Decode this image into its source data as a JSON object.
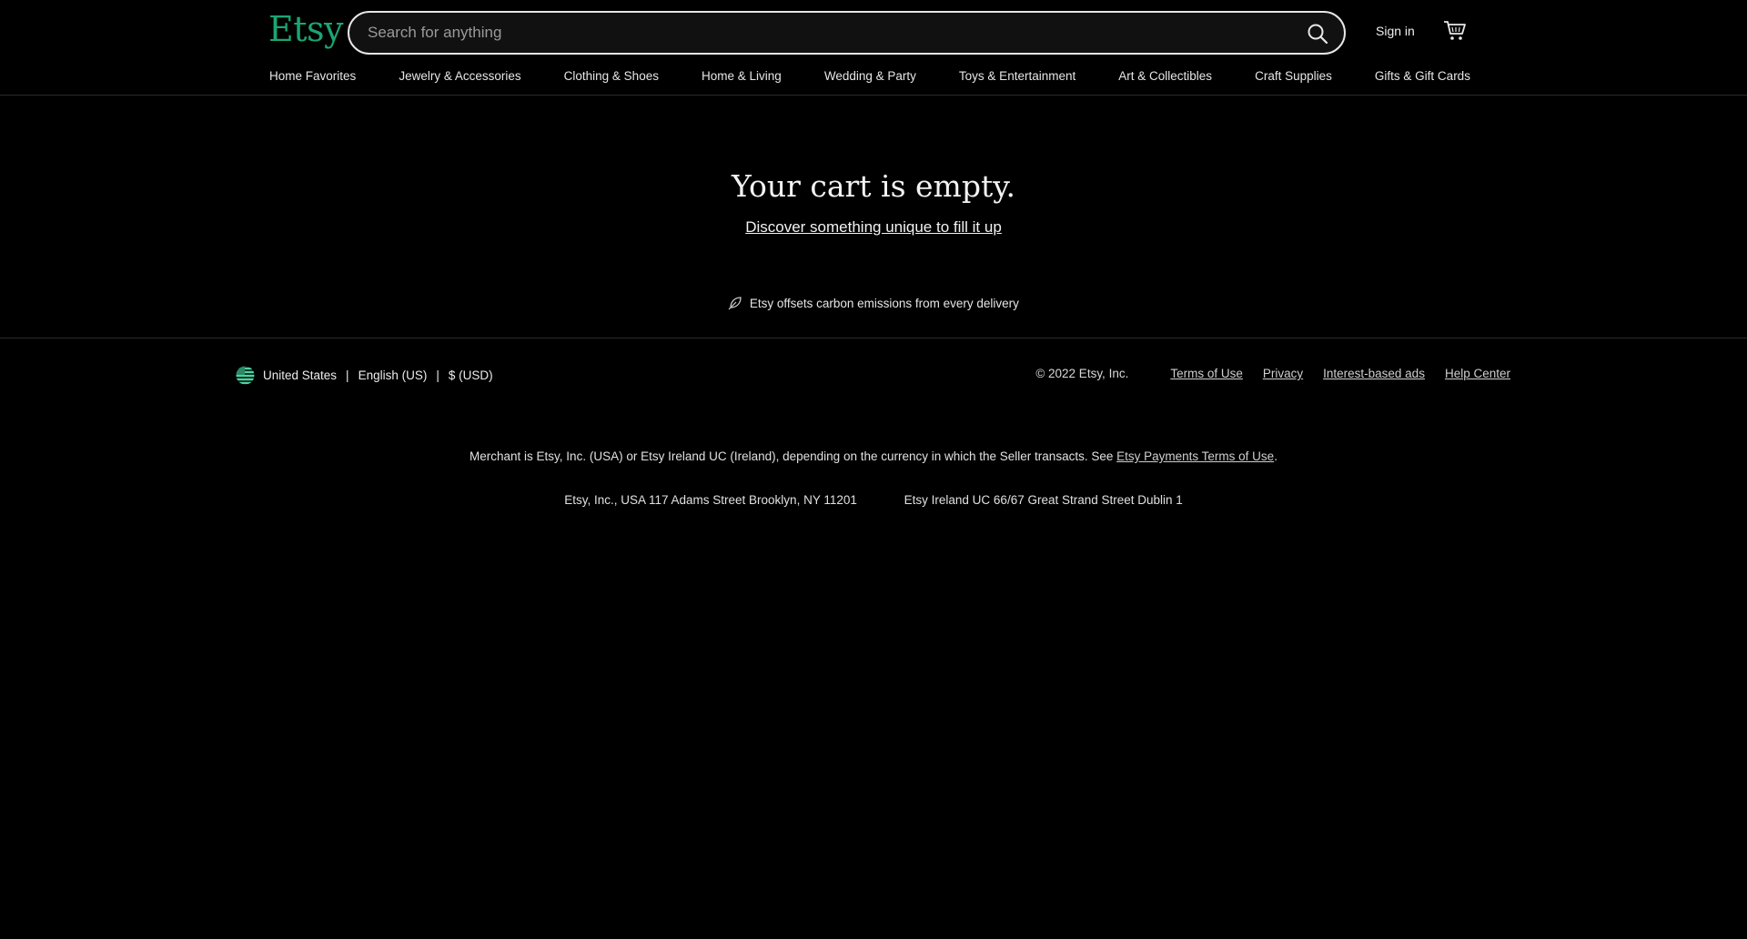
{
  "header": {
    "logo": "Etsy",
    "search_placeholder": "Search for anything",
    "sign_in": "Sign in"
  },
  "nav": {
    "items": [
      "Home Favorites",
      "Jewelry & Accessories",
      "Clothing & Shoes",
      "Home & Living",
      "Wedding & Party",
      "Toys & Entertainment",
      "Art & Collectibles",
      "Craft Supplies",
      "Gifts & Gift Cards"
    ]
  },
  "main": {
    "title": "Your cart is empty.",
    "discover_link": "Discover something unique to fill it up",
    "carbon_note": "Etsy offsets carbon emissions from every delivery"
  },
  "footer": {
    "locale": {
      "country": "United States",
      "language": "English (US)",
      "currency": "$ (USD)",
      "separator": "|"
    },
    "copyright": "© 2022 Etsy, Inc.",
    "links": [
      "Terms of Use",
      "Privacy",
      "Interest-based ads",
      "Help Center"
    ],
    "merchant_text": "Merchant is Etsy, Inc. (USA) or Etsy Ireland UC (Ireland), depending on the currency in which the Seller transacts. See",
    "merchant_link": "Etsy Payments Terms of Use",
    "merchant_end": ".",
    "address_us": "Etsy, Inc., USA 117 Adams Street Brooklyn, NY 11201",
    "address_ie": "Etsy Ireland UC 66/67 Great Strand Street Dublin 1"
  },
  "colors": {
    "brand": "#1aa672",
    "background": "#000000",
    "text": "#e8e8e8"
  },
  "icons": {
    "search": "search-icon",
    "cart": "cart-icon",
    "leaf": "leaf-icon",
    "flag": "us-flag-icon"
  }
}
